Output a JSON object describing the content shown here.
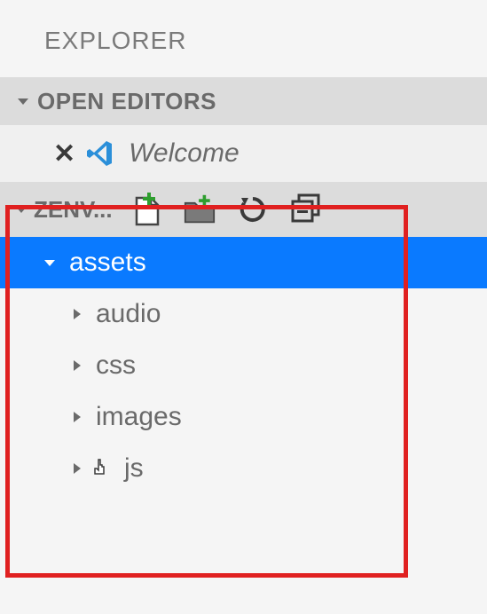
{
  "explorer": {
    "title": "EXPLORER"
  },
  "openEditors": {
    "header": "OPEN EDITORS",
    "items": [
      {
        "label": "Welcome"
      }
    ]
  },
  "project": {
    "name": "ZENV..."
  },
  "tree": {
    "root": {
      "label": "assets"
    },
    "children": [
      {
        "label": "audio"
      },
      {
        "label": "css"
      },
      {
        "label": "images"
      },
      {
        "label": "js"
      }
    ]
  }
}
